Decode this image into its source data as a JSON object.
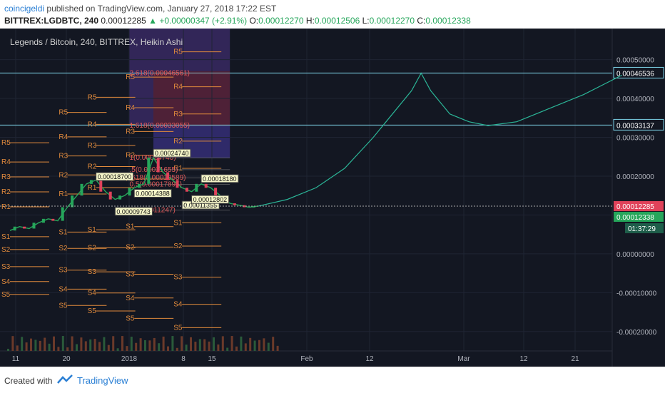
{
  "header": {
    "author": "coincigeldi",
    "published_text": "published on TradingView.com, January 27, 2018 17:22 EST",
    "symbol": "BITTREX:LGDBTC, 240",
    "last": "0.00012285",
    "change": "▲ +0.00000347 (+2.91%)",
    "o_label": "O:",
    "o_value": "0.00012270",
    "h_label": "H:",
    "h_value": "0.00012506",
    "l_label": "L:",
    "l_value": "0.00012270",
    "c_label": "C:",
    "c_value": "0.00012338"
  },
  "legend_title": "Legends / Bitcoin, 240, BITTREX, Heikin Ashi",
  "footer": {
    "created_with": "Created with",
    "brand": "TradingView"
  },
  "colors": {
    "background": "#131722",
    "grid": "#1f2433",
    "pivot": "#e08a3c",
    "hline": "#7ed3e8",
    "projection": "#2bb597",
    "up_candle": "#26a65b",
    "down_candle": "#e0425a",
    "current_price_tag": "#e0425a",
    "close_tag": "#26a65b",
    "purple_zone": "#3b2a66",
    "red_zone": "#5a1f2a"
  },
  "chart_data": {
    "type": "line",
    "title": "Legends / Bitcoin, 240, BITTREX, Heikin Ashi",
    "xlabel": "",
    "ylabel": "",
    "ylim": [
      -0.00025,
      0.00058
    ],
    "x_tick_labels": [
      "11",
      "20",
      "2018",
      "8",
      "15",
      "Feb",
      "12",
      "Mar",
      "12",
      "21"
    ],
    "y_tick_labels": [
      "0.00050000",
      "0.00040000",
      "0.00030000",
      "0.00020000",
      "0.00010000",
      "0.00000000",
      "-0.00010000",
      "-0.00020000"
    ],
    "y_tick_values": [
      0.0005,
      0.0004,
      0.0003,
      0.0002,
      0.0001,
      0.0,
      -0.0001,
      -0.0002
    ],
    "horizontal_levels": [
      {
        "label": "0.00046536",
        "value": 0.00046536
      },
      {
        "label": "0.00033137",
        "value": 0.00033137
      }
    ],
    "price_tags": {
      "current": {
        "label": "0.00012285",
        "value": 0.00012285
      },
      "close": {
        "label": "0.00012338",
        "value": 0.00012338
      },
      "countdown": "01:37:29"
    },
    "price_series_x_days": [
      0,
      2,
      4,
      6,
      8,
      10,
      12,
      14,
      16,
      18,
      20,
      22,
      24,
      26,
      28,
      30,
      32,
      34,
      36,
      38,
      40,
      42,
      44,
      46,
      48,
      50,
      52
    ],
    "price_series": [
      6e-05,
      7e-05,
      6.5e-05,
      8e-05,
      9e-05,
      8.5e-05,
      0.00012,
      0.00015,
      0.00018,
      0.00019,
      0.00016,
      0.00014,
      0.00015,
      0.00017,
      0.00018,
      0.000247,
      0.00021,
      0.00019,
      0.00017,
      0.00016,
      0.00018,
      0.00017,
      0.00015,
      0.00013,
      0.000125,
      0.00012,
      0.000123
    ],
    "projection_x_days": [
      52,
      58,
      64,
      70,
      76,
      80,
      84,
      86,
      88,
      92,
      96,
      100,
      106,
      112,
      120,
      128
    ],
    "projection": [
      0.000123,
      0.00014,
      0.00017,
      0.00022,
      0.0003,
      0.00036,
      0.00042,
      0.000465,
      0.00042,
      0.00036,
      0.00034,
      0.00033,
      0.00034,
      0.00037,
      0.00041,
      0.00046
    ],
    "fib_labels": [
      {
        "text": "2.618(0.00046561)",
        "value": 0.00046561
      },
      {
        "text": "1.618(0.00033055)",
        "value": 0.00033055
      },
      {
        "text": "1(0.00024740)",
        "value": 0.0002474
      },
      {
        "text": ".5(0.00021655)",
        "value": 0.00021655
      },
      {
        "text": ".618(0.00019589)",
        "value": 0.00019589
      },
      {
        "text": "0.5(0.00017895)",
        "value": 0.00017895
      },
      {
        "text": "0(0.00011247)",
        "value": 0.00011247
      }
    ],
    "point_labels": [
      {
        "text": "0.00024740",
        "day": 30,
        "value": 0.0002474
      },
      {
        "text": "0.00018700",
        "day": 18,
        "value": 0.000187
      },
      {
        "text": "0.00018180",
        "day": 40,
        "value": 0.0001818
      },
      {
        "text": "0.00014388",
        "day": 26,
        "value": 0.00014388
      },
      {
        "text": "0.00011355",
        "day": 36,
        "value": 0.00011355
      },
      {
        "text": "0.00009743",
        "day": 22,
        "value": 9.743e-05
      },
      {
        "text": "0.00012802",
        "day": 38,
        "value": 0.00012802
      }
    ],
    "pivot_groups": [
      {
        "day": 0,
        "labels": [
          "R5",
          "R4",
          "R3",
          "R2",
          "R1",
          "S1",
          "S2",
          "S3",
          "S4",
          "S5"
        ]
      },
      {
        "day": 12,
        "labels": [
          "R5",
          "R4",
          "R3",
          "R2",
          "R1",
          "S1",
          "S2",
          "S3",
          "S4",
          "S5"
        ]
      },
      {
        "day": 18,
        "labels": [
          "R5",
          "R4",
          "R3",
          "R2",
          "R1",
          "S1",
          "S2",
          "S3",
          "S4",
          "S5"
        ]
      },
      {
        "day": 26,
        "labels": [
          "R5",
          "R4",
          "R3",
          "R2",
          "R1",
          "S1",
          "S2",
          "S3",
          "S4",
          "S5"
        ]
      },
      {
        "day": 36,
        "labels": [
          "R5",
          "R4",
          "R3",
          "R2",
          "R1",
          "S1",
          "S2",
          "S3",
          "S4",
          "S5"
        ]
      }
    ]
  }
}
